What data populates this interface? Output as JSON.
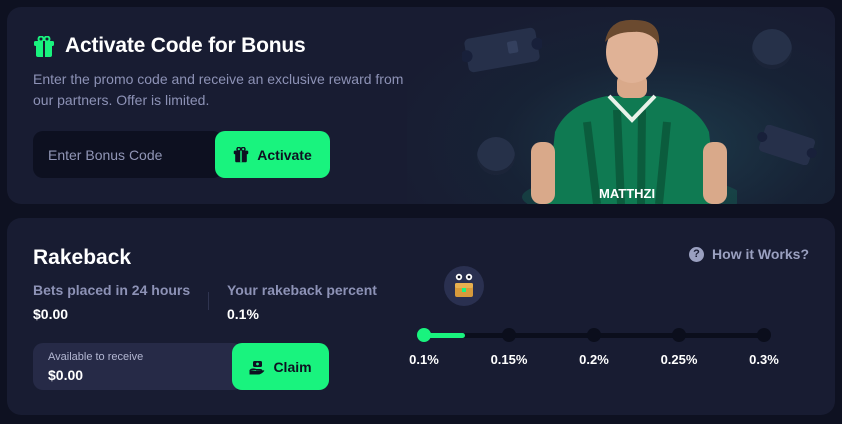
{
  "bonus": {
    "title": "Activate Code for Bonus",
    "description": "Enter the promo code and receive an exclusive reward from us and our partners. Offer is limited.",
    "input_placeholder": "Enter Bonus Code",
    "activate_label": "Activate",
    "icon": "gift-icon",
    "hero_icons": [
      "ticket-icon",
      "coin-icon"
    ],
    "hero_jersey_text": "MATTHZI"
  },
  "rakeback": {
    "title": "Rakeback",
    "how_it_works": "How it Works?",
    "bets_label": "Bets placed in 24 hours",
    "bets_value": "$0.00",
    "percent_label": "Your rakeback percent",
    "percent_value": "0.1%",
    "receive_label": "Available to receive",
    "receive_value": "$0.00",
    "claim_label": "Claim",
    "levels": [
      "0.1%",
      "0.15%",
      "0.2%",
      "0.25%",
      "0.3%"
    ],
    "current_level_index": 0,
    "progress_fraction": 0.12
  },
  "colors": {
    "accent": "#19f37e",
    "card_bg": "#181c32",
    "page_bg": "#0e1121",
    "muted_text": "#8d92b6"
  }
}
